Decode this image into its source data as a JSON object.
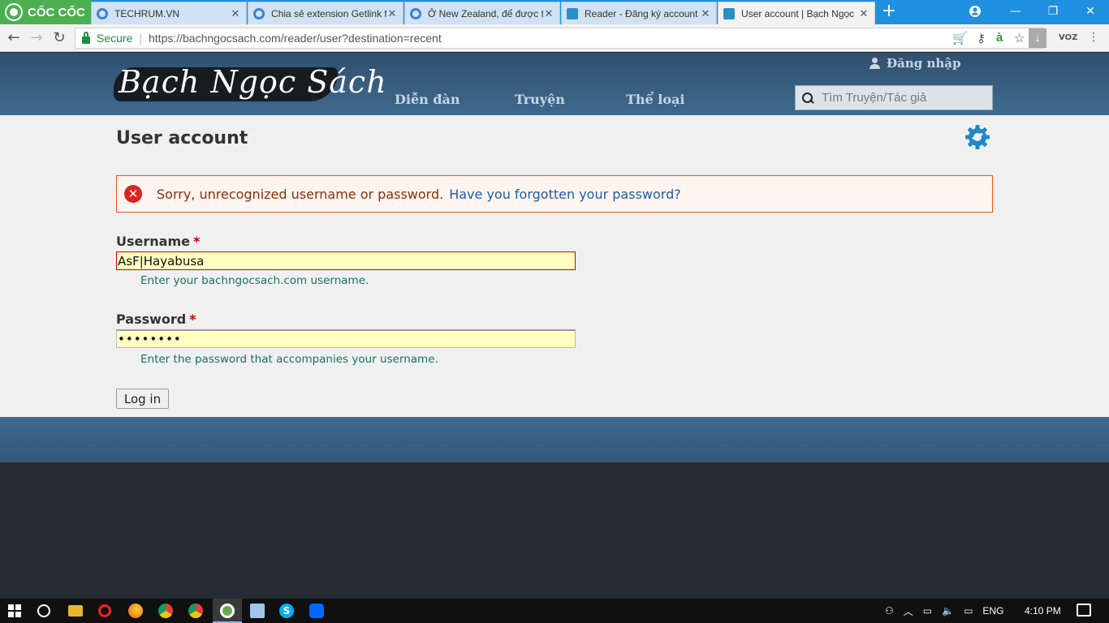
{
  "browser": {
    "brand": "CỐC CỐC",
    "tabs": [
      {
        "label": "TECHRUM.VN"
      },
      {
        "label": "Chia sẻ extension Getlink f"
      },
      {
        "label": "Ở New Zealand, để được t"
      },
      {
        "label": "Reader - Đăng ký account"
      },
      {
        "label": "User account | Bạch Ngọc"
      }
    ],
    "secure_label": "Secure",
    "separator": "|",
    "url": "https://bachngocsach.com/reader/user?destination=recent"
  },
  "site": {
    "logo_text": "Bạch Ngọc Sách",
    "login_link": "Đăng nhập",
    "nav": [
      {
        "label": "Diễn đàn"
      },
      {
        "label": "Truyện"
      },
      {
        "label": "Thể loại"
      }
    ],
    "search_placeholder": "Tìm Truyện/Tác giả"
  },
  "page": {
    "title": "User account",
    "error_message": "Sorry, unrecognized username or password.",
    "forgot_link": "Have you forgotten your password?",
    "username_label": "Username",
    "required_mark": "*",
    "username_value": "AsF|Hayabusa",
    "username_desc": "Enter your bachngocsach.com username.",
    "password_label": "Password",
    "password_value": "••••••••",
    "password_desc": "Enter the password that accompanies your username.",
    "login_button": "Log in"
  },
  "taskbar": {
    "language": "ENG",
    "time": "4:10 PM"
  },
  "colors": {
    "header": "#3e6a8f",
    "error_border": "#ed541d",
    "error_text": "#8c2e0b",
    "link": "#1f5ba1",
    "input_bg": "#ffffc0",
    "desc_text": "#157366"
  }
}
